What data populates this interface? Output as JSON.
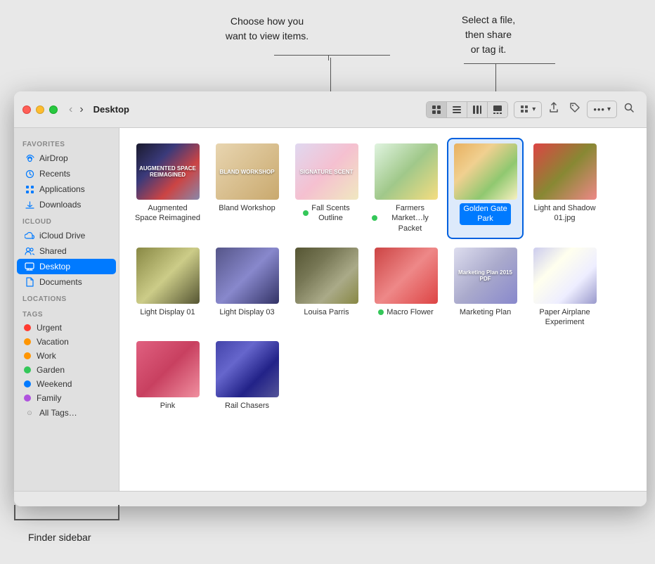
{
  "window": {
    "title": "Desktop"
  },
  "callouts": {
    "view_label": "Choose how you\nwant to view items.",
    "share_label": "Select a file,\nthen share\nor tag it.",
    "sidebar_label": "Finder sidebar"
  },
  "toolbar": {
    "back": "‹",
    "forward": "›",
    "view_icon": "⊞",
    "list_icon": "☰",
    "column_icon": "⊟",
    "gallery_icon": "⊡",
    "group_icon": "⊞",
    "share_icon": "↑",
    "tag_icon": "◇",
    "more_icon": "···",
    "search_icon": "🔍"
  },
  "sidebar": {
    "favorites_label": "Favorites",
    "icloud_label": "iCloud",
    "locations_label": "Locations",
    "tags_label": "Tags",
    "items": [
      {
        "id": "airdrop",
        "label": "AirDrop",
        "icon": "📡"
      },
      {
        "id": "recents",
        "label": "Recents",
        "icon": "🕐"
      },
      {
        "id": "applications",
        "label": "Applications",
        "icon": "🚀"
      },
      {
        "id": "downloads",
        "label": "Downloads",
        "icon": "⬇"
      },
      {
        "id": "icloud-drive",
        "label": "iCloud Drive",
        "icon": "☁"
      },
      {
        "id": "shared",
        "label": "Shared",
        "icon": "👥"
      },
      {
        "id": "desktop",
        "label": "Desktop",
        "icon": "🖥",
        "active": true
      },
      {
        "id": "documents",
        "label": "Documents",
        "icon": "📄"
      }
    ],
    "tags": [
      {
        "id": "urgent",
        "label": "Urgent",
        "color": "#ff3b30"
      },
      {
        "id": "vacation",
        "label": "Vacation",
        "color": "#ff9500"
      },
      {
        "id": "work",
        "label": "Work",
        "color": "#ff9500"
      },
      {
        "id": "garden",
        "label": "Garden",
        "color": "#34c759"
      },
      {
        "id": "weekend",
        "label": "Weekend",
        "color": "#007aff"
      },
      {
        "id": "family",
        "label": "Family",
        "color": "#af52de"
      },
      {
        "id": "all-tags",
        "label": "All Tags…",
        "color": "#999"
      }
    ]
  },
  "files": [
    {
      "id": "augmented",
      "label": "Augmented\nSpace Reimagined",
      "thumb_class": "thumb-augmented",
      "thumb_text": "AUGMENTED\nSPACE\nREIMAGINED",
      "tag": null,
      "selected": false
    },
    {
      "id": "bland",
      "label": "Bland Workshop",
      "thumb_class": "thumb-bland",
      "thumb_text": "BLAND\nWORKSHOP",
      "tag": null,
      "selected": false
    },
    {
      "id": "fall",
      "label": "Fall Scents\nOutline",
      "thumb_class": "thumb-fall",
      "thumb_text": "SIGNATURE\nSCENT",
      "tag": "green",
      "selected": false
    },
    {
      "id": "farmers",
      "label": "Farmers\nMarket…ly Packet",
      "thumb_class": "thumb-farmers",
      "thumb_text": "",
      "tag": "green",
      "selected": false
    },
    {
      "id": "golden",
      "label": "Golden Gate\nPark",
      "thumb_class": "thumb-golden",
      "thumb_text": "",
      "tag": null,
      "selected": true
    },
    {
      "id": "light-shadow",
      "label": "Light and Shadow\n01.jpg",
      "thumb_class": "thumb-light-shadow",
      "thumb_text": "",
      "tag": null,
      "selected": false
    },
    {
      "id": "light01",
      "label": "Light Display 01",
      "thumb_class": "thumb-light01",
      "thumb_text": "",
      "tag": null,
      "selected": false
    },
    {
      "id": "light03",
      "label": "Light Display 03",
      "thumb_class": "thumb-light03",
      "thumb_text": "",
      "tag": null,
      "selected": false
    },
    {
      "id": "louisa",
      "label": "Louisa Parris",
      "thumb_class": "thumb-louisa",
      "thumb_text": "",
      "tag": null,
      "selected": false
    },
    {
      "id": "macro",
      "label": "Macro Flower",
      "thumb_class": "thumb-macro",
      "thumb_text": "",
      "tag": "green",
      "selected": false
    },
    {
      "id": "marketing",
      "label": "Marketing Plan",
      "thumb_class": "thumb-marketing",
      "thumb_text": "Marketing\nPlan\n2015\nPDF",
      "tag": null,
      "selected": false
    },
    {
      "id": "paper",
      "label": "Paper Airplane\nExperiment",
      "thumb_class": "thumb-paper",
      "thumb_text": "",
      "tag": null,
      "selected": false
    },
    {
      "id": "pink",
      "label": "Pink",
      "thumb_class": "thumb-pink",
      "thumb_text": "",
      "tag": null,
      "selected": false
    },
    {
      "id": "rail",
      "label": "Rail Chasers",
      "thumb_class": "thumb-rail",
      "thumb_text": "",
      "tag": null,
      "selected": false
    }
  ]
}
